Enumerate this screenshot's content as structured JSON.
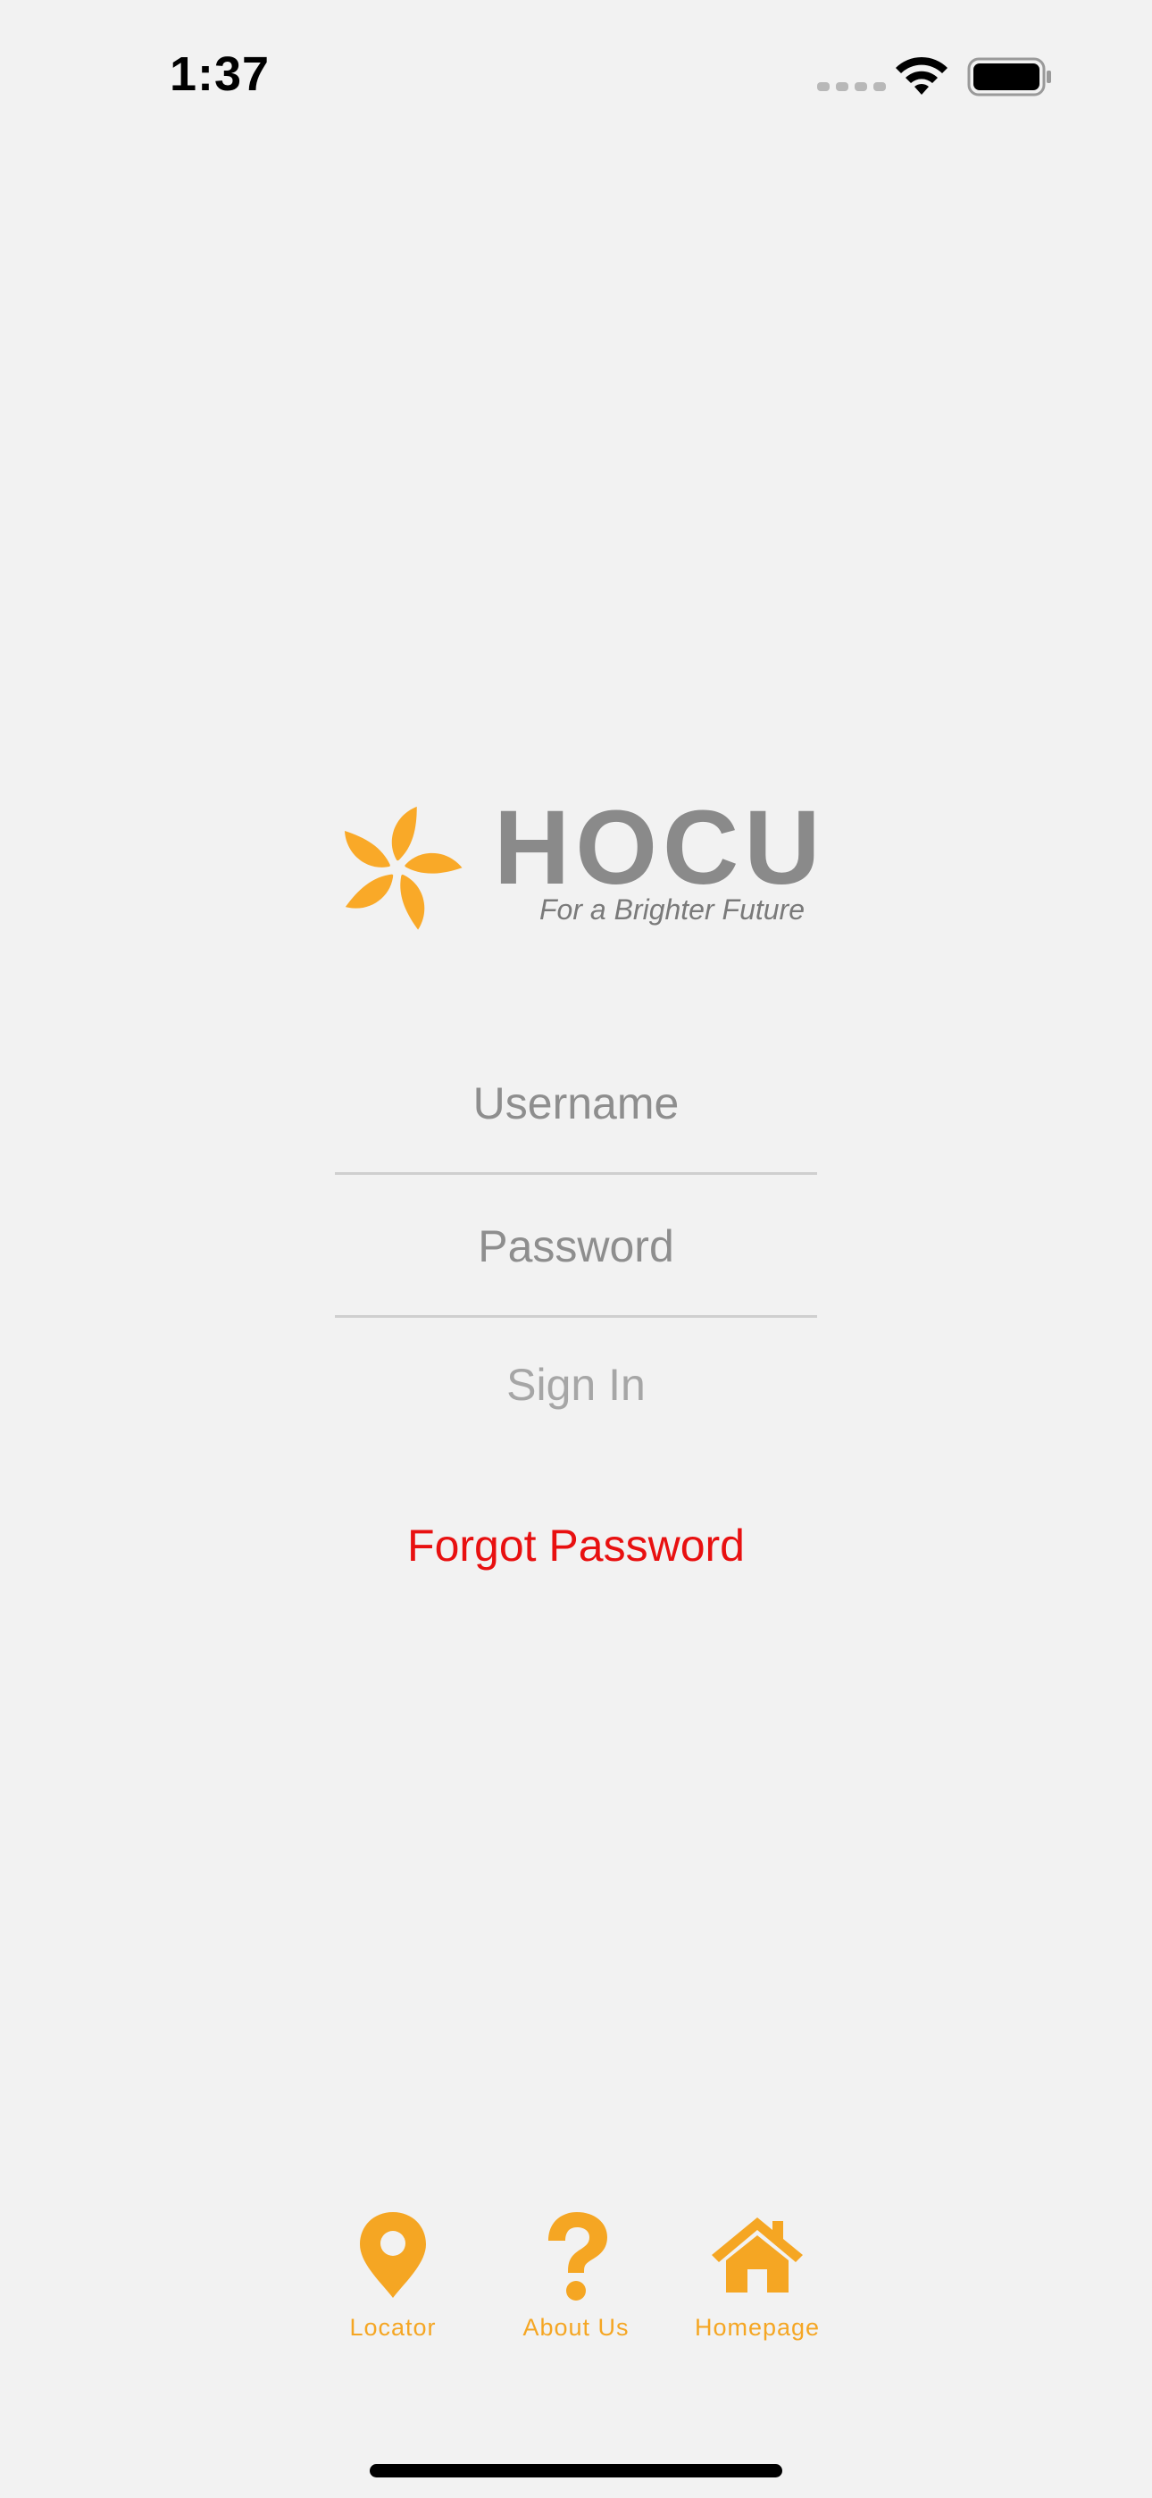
{
  "status_bar": {
    "time": "1:37"
  },
  "logo": {
    "name": "HOCU",
    "tagline": "For a Brighter Future",
    "icon": "flower-logo-icon"
  },
  "login": {
    "username_placeholder": "Username",
    "username_value": "",
    "password_placeholder": "Password",
    "password_value": "",
    "sign_in_label": "Sign In",
    "forgot_password_label": "Forgot Password"
  },
  "tabbar": {
    "items": [
      {
        "label": "Locator",
        "icon": "map-pin-icon"
      },
      {
        "label": "About Us",
        "icon": "question-mark-icon"
      },
      {
        "label": "Homepage",
        "icon": "home-icon"
      }
    ]
  },
  "colors": {
    "background": "#f2f2f2",
    "accent": "#f5a623",
    "logo_text": "#8a8a8a",
    "forgot_password": "#e81010",
    "sign_in_disabled": "#a6a6a6"
  }
}
